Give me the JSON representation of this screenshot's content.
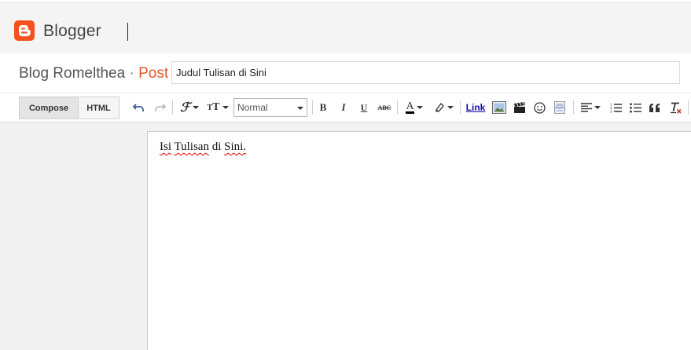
{
  "header": {
    "brand": "Blogger"
  },
  "post": {
    "blog_name": "Blog Romelthea",
    "separator": "·",
    "section": "Post",
    "title_value": "Judul Tulisan di Sini"
  },
  "toolbar": {
    "compose_label": "Compose",
    "html_label": "HTML",
    "format_value": "Normal",
    "bold_label": "B",
    "italic_label": "I",
    "underline_label": "U",
    "strike_label": "ABC",
    "text_color_label": "A",
    "link_label": "Link",
    "icons": [
      "undo-icon",
      "redo-icon",
      "font-family-icon",
      "font-size-icon",
      "text-color-icon",
      "highlight-icon",
      "image-icon",
      "video-icon",
      "emoji-icon",
      "jump-break-icon",
      "align-icon",
      "numbered-list-icon",
      "bullet-list-icon",
      "quote-icon",
      "clear-format-icon"
    ]
  },
  "editor": {
    "words": [
      "Isi",
      "Tulisan",
      "di",
      "Sini."
    ]
  },
  "colors": {
    "accent": "#f4511e",
    "post_label": "#e0592a",
    "link": "#1a0dab"
  }
}
